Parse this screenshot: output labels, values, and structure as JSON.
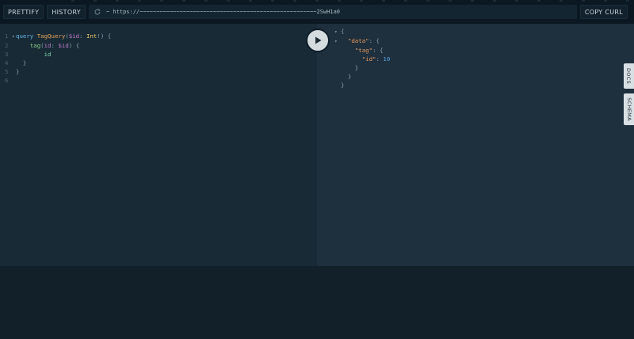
{
  "toolbar": {
    "prettify_label": "PRETTIFY",
    "history_label": "HISTORY",
    "endpoint_url": "~ https://~~~~~~~~~~~~~~~~~~~~~~~~~~~~~~~~~~~~~~~~~~~~~~~~~~~~~2SwH1a0",
    "copy_curl_label": "COPY CURL"
  },
  "query_editor": {
    "lines": [
      {
        "n": "1",
        "fold": "▾",
        "tokens": [
          [
            "kw",
            "query "
          ],
          [
            "def",
            "TagQuery"
          ],
          [
            "punc",
            "("
          ],
          [
            "var",
            "$id"
          ],
          [
            "punc",
            ": "
          ],
          [
            "type",
            "Int"
          ],
          [
            "punc",
            "!) {"
          ]
        ]
      },
      {
        "n": "2",
        "fold": "",
        "tokens": [
          [
            "punc",
            "    "
          ],
          [
            "fn",
            "tag"
          ],
          [
            "punc",
            "("
          ],
          [
            "var",
            "id"
          ],
          [
            "punc",
            ": "
          ],
          [
            "var",
            "$id"
          ],
          [
            "punc",
            ") {"
          ]
        ]
      },
      {
        "n": "3",
        "fold": "",
        "tokens": [
          [
            "punc",
            "        "
          ],
          [
            "prop",
            "id"
          ]
        ]
      },
      {
        "n": "4",
        "fold": "",
        "tokens": [
          [
            "punc",
            "  }"
          ]
        ]
      },
      {
        "n": "5",
        "fold": "",
        "tokens": [
          [
            "punc",
            "}"
          ]
        ]
      },
      {
        "n": "6",
        "fold": "",
        "tokens": [
          [
            "punc",
            ""
          ]
        ]
      }
    ]
  },
  "result_viewer": {
    "lines": [
      {
        "fold": "▾",
        "tokens": [
          [
            "punc",
            "{"
          ]
        ]
      },
      {
        "fold": "▾",
        "tokens": [
          [
            "punc",
            "  "
          ],
          [
            "key",
            "\"data\""
          ],
          [
            "punc",
            ": {"
          ]
        ]
      },
      {
        "fold": "",
        "tokens": [
          [
            "punc",
            "    "
          ],
          [
            "key",
            "\"tag\""
          ],
          [
            "punc",
            ": {"
          ]
        ]
      },
      {
        "fold": "",
        "tokens": [
          [
            "punc",
            "      "
          ],
          [
            "key",
            "\"id\""
          ],
          [
            "punc",
            ": "
          ],
          [
            "num",
            "10"
          ]
        ]
      },
      {
        "fold": "",
        "tokens": [
          [
            "punc",
            "    }"
          ]
        ]
      },
      {
        "fold": "",
        "tokens": [
          [
            "punc",
            "  }"
          ]
        ]
      },
      {
        "fold": "",
        "tokens": [
          [
            "punc",
            "}"
          ]
        ]
      }
    ]
  },
  "side_tabs": {
    "docs_label": "DOCS",
    "schema_label": "SCHEMA"
  },
  "icons": {
    "run": "play-icon",
    "reload": "reload-icon"
  }
}
